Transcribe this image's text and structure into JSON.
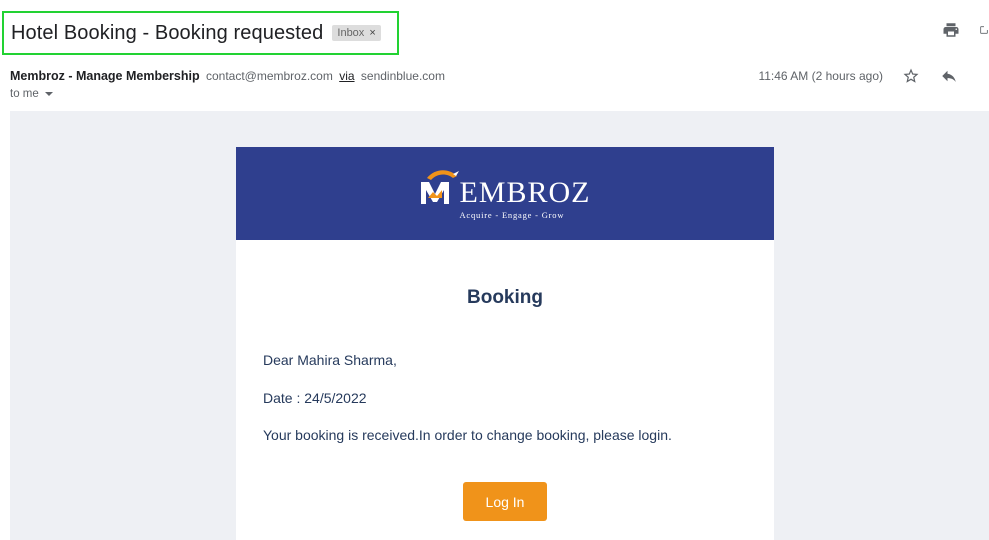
{
  "email": {
    "subject": "Hotel Booking - Booking requested",
    "label_chip": "Inbox",
    "label_chip_remove": "×",
    "sender_name": "Membroz - Manage Membership",
    "sender_email": "contact@membroz.com",
    "via_label": "via",
    "via_domain": "sendinblue.com",
    "recipient": "to me",
    "timestamp": "11:46 AM (2 hours ago)"
  },
  "icons": {
    "print": "print-icon",
    "popout": "open-in-new-window-icon",
    "star": "star-icon",
    "reply": "reply-icon"
  },
  "body": {
    "brand_logo_text": "EMBROZ",
    "brand_tagline": "Acquire - Engage - Grow",
    "heading": "Booking",
    "greeting": "Dear Mahira Sharma,",
    "date_line": "Date : 24/5/2022",
    "message": "Your booking is received.In order to change booking, please login.",
    "button_label": "Log In"
  },
  "colors": {
    "banner": "#2f3f8e",
    "accent_orange": "#f0931a",
    "heading_text": "#263a5c",
    "highlight_border": "#22d232",
    "canvas_bg": "#eef0f4"
  }
}
